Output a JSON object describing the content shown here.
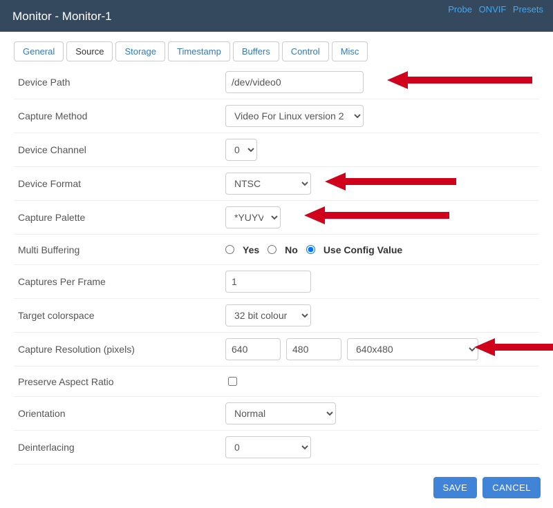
{
  "header": {
    "title": "Monitor - Monitor-1",
    "links": {
      "probe": "Probe",
      "onvif": "ONVIF",
      "presets": "Presets"
    }
  },
  "tabs": [
    "General",
    "Source",
    "Storage",
    "Timestamp",
    "Buffers",
    "Control",
    "Misc"
  ],
  "active_tab": "Source",
  "fields": {
    "device_path": {
      "label": "Device Path",
      "value": "/dev/video0"
    },
    "capture_method": {
      "label": "Capture Method",
      "value": "Video For Linux version 2"
    },
    "device_channel": {
      "label": "Device Channel",
      "value": "0"
    },
    "device_format": {
      "label": "Device Format",
      "value": "NTSC"
    },
    "capture_palette": {
      "label": "Capture Palette",
      "value": "*YUYV"
    },
    "multi_buffering": {
      "label": "Multi Buffering",
      "options": {
        "yes": "Yes",
        "no": "No",
        "config": "Use Config Value"
      },
      "selected": "config"
    },
    "captures_per_frame": {
      "label": "Captures Per Frame",
      "value": "1"
    },
    "target_colorspace": {
      "label": "Target colorspace",
      "value": "32 bit colour"
    },
    "capture_resolution": {
      "label": "Capture Resolution (pixels)",
      "width": "640",
      "height": "480",
      "preset": "640x480"
    },
    "preserve_aspect": {
      "label": "Preserve Aspect Ratio",
      "checked": false
    },
    "orientation": {
      "label": "Orientation",
      "value": "Normal"
    },
    "deinterlacing": {
      "label": "Deinterlacing",
      "value": "0"
    }
  },
  "buttons": {
    "save": "SAVE",
    "cancel": "CANCEL"
  },
  "annotations": {
    "arrow_color": "#d0021b"
  }
}
